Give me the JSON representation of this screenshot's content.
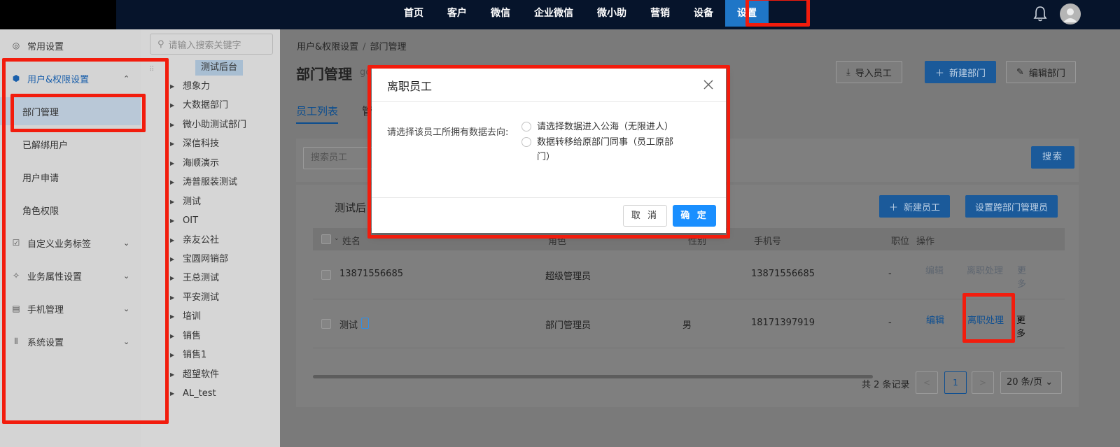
{
  "topnav": [
    "首页",
    "客户",
    "微信",
    "企业微信",
    "微小助",
    "营销",
    "设备",
    "设置"
  ],
  "sidebar": {
    "common": "常用设置",
    "user_perm": "用户&权限设置",
    "dept": "部门管理",
    "unbound": "已解绑用户",
    "apply": "用户申请",
    "roles": "角色权限",
    "tags": "自定义业务标签",
    "attrs": "业务属性设置",
    "phone": "手机管理",
    "system": "系统设置"
  },
  "tree": {
    "search_placeholder": "请输入搜索关键字",
    "nodes": [
      "测试后台",
      "想象力",
      "大数据部门",
      "微小助测试部门",
      "深信科技",
      "海顺演示",
      "涛普服装测试",
      "测试",
      "OIT",
      "亲友公社",
      "宝圆网销部",
      "王总测试",
      "平安测试",
      "培训",
      "销售",
      "销售1",
      "超望软件",
      "AL_test"
    ]
  },
  "main": {
    "breadcrumb": [
      "用户&权限设置",
      "部门管理"
    ],
    "breadcrumb_sep": "/",
    "title": "部门管理",
    "subtitle_fragment": "go",
    "import_btn": "导入员工",
    "new_dept_btn": "新建部门",
    "edit_dept_btn": "编辑部门",
    "tab_staff": "员工列表",
    "tab_other": "管",
    "search_placeholder": "搜索员工",
    "search_btn": "搜索",
    "box_title": "测试后",
    "new_staff_btn": "新建员工",
    "cross_admin_btn": "设置跨部门管理员"
  },
  "table": {
    "columns": [
      "姓名",
      "角色",
      "性别",
      "手机号",
      "职位",
      "操作"
    ],
    "rows": [
      {
        "name": "13871556685",
        "role": "超级管理员",
        "gender": "",
        "phone": "13871556685",
        "position": "-",
        "edit": "编辑",
        "resign": "离职处理",
        "more": "更多"
      },
      {
        "name": "测试",
        "role": "部门管理员",
        "gender": "男",
        "phone": "18171397919",
        "position": "-",
        "edit": "编辑",
        "resign": "离职处理",
        "more": "更多"
      }
    ]
  },
  "pagination": {
    "total": "共 2 条记录",
    "current": "1",
    "prev": "<",
    "next": ">",
    "page_size": "20 条/页"
  },
  "modal": {
    "title": "离职员工",
    "question": "请选择该员工所拥有数据去向:",
    "option1": "请选择数据进入公海（无限进人）",
    "option2_line1": "数据转移给原部门同事（员工原部",
    "option2_line2": "门）",
    "cancel": "取 消",
    "ok": "确 定"
  },
  "colors": {
    "accent": "#1a8fff",
    "highlight": "#f21c0d",
    "nav_bg": "#06142b"
  }
}
